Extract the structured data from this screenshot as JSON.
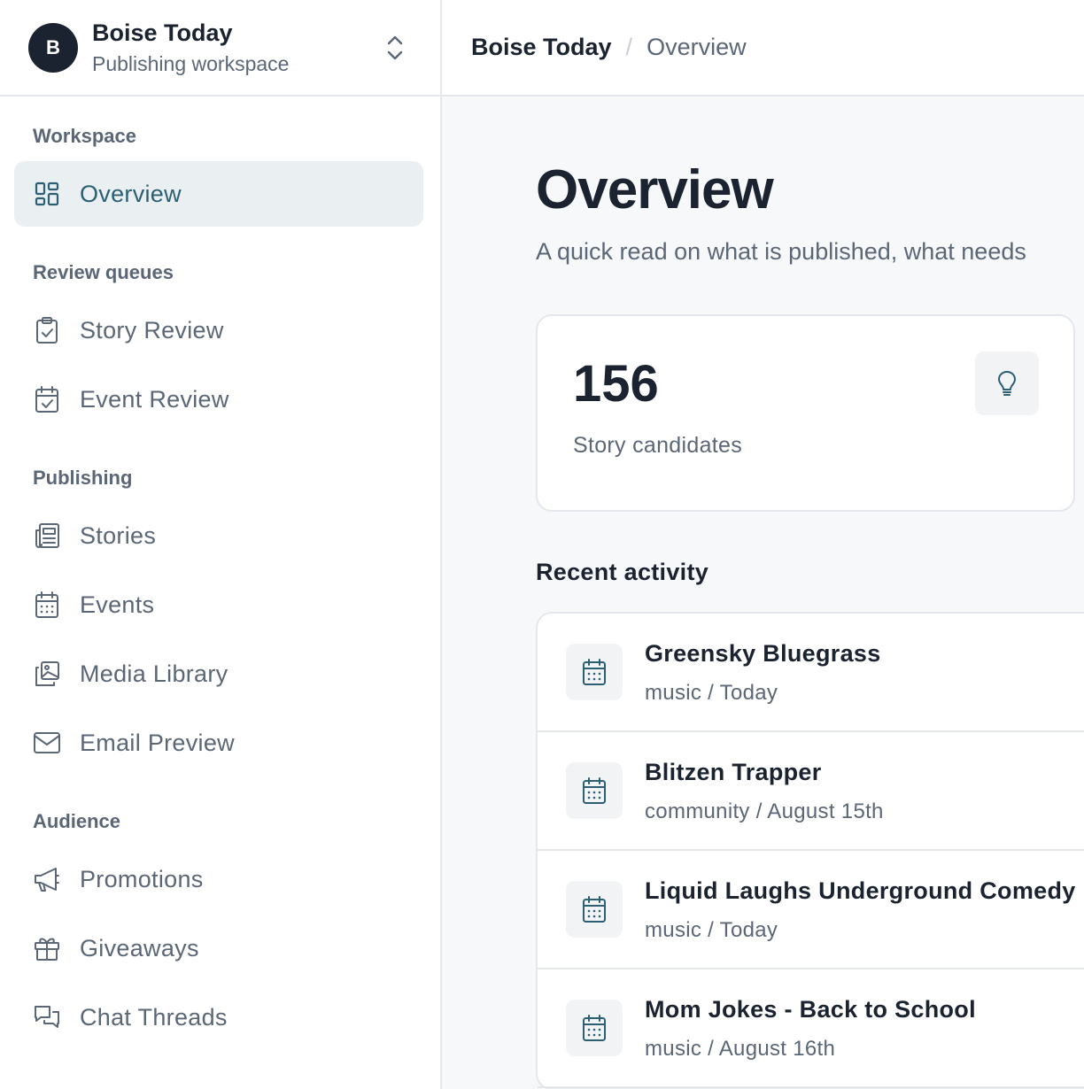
{
  "workspace": {
    "initial": "B",
    "name": "Boise Today",
    "subtitle": "Publishing workspace"
  },
  "sidebar": {
    "sections": [
      {
        "title": "Workspace"
      },
      {
        "title": "Review queues"
      },
      {
        "title": "Publishing"
      },
      {
        "title": "Audience"
      }
    ],
    "items": [
      {
        "label": "Overview",
        "icon": "grid-icon",
        "active": true
      },
      {
        "label": "Story Review",
        "icon": "clipboard-check-icon"
      },
      {
        "label": "Event Review",
        "icon": "calendar-check-icon"
      },
      {
        "label": "Stories",
        "icon": "newspaper-icon"
      },
      {
        "label": "Events",
        "icon": "calendar-icon"
      },
      {
        "label": "Media Library",
        "icon": "images-icon"
      },
      {
        "label": "Email Preview",
        "icon": "mail-icon"
      },
      {
        "label": "Promotions",
        "icon": "megaphone-icon"
      },
      {
        "label": "Giveaways",
        "icon": "gift-icon"
      },
      {
        "label": "Chat Threads",
        "icon": "chat-bubbles-icon"
      }
    ]
  },
  "breadcrumb": {
    "root": "Boise Today",
    "separator": "/",
    "current": "Overview"
  },
  "main": {
    "title": "Overview",
    "subtitle": "A quick read on what is published, what needs",
    "stat": {
      "value": "156",
      "label": "Story candidates",
      "icon": "lightbulb-icon"
    },
    "activity_title": "Recent activity",
    "activity": [
      {
        "title": "Greensky Bluegrass",
        "meta": "music / Today",
        "icon": "calendar-icon"
      },
      {
        "title": "Blitzen Trapper",
        "meta": "community / August 15th",
        "icon": "calendar-icon"
      },
      {
        "title": "Liquid Laughs Underground Comedy",
        "meta": "music / Today",
        "icon": "calendar-icon"
      },
      {
        "title": "Mom Jokes - Back to School",
        "meta": "music / August 16th",
        "icon": "calendar-icon"
      }
    ]
  },
  "colors": {
    "accent": "#2c5f73",
    "active_bg": "#eaf0f2",
    "text_primary": "#1b2330",
    "text_muted": "#5b6676",
    "border": "#e4e7eb"
  }
}
